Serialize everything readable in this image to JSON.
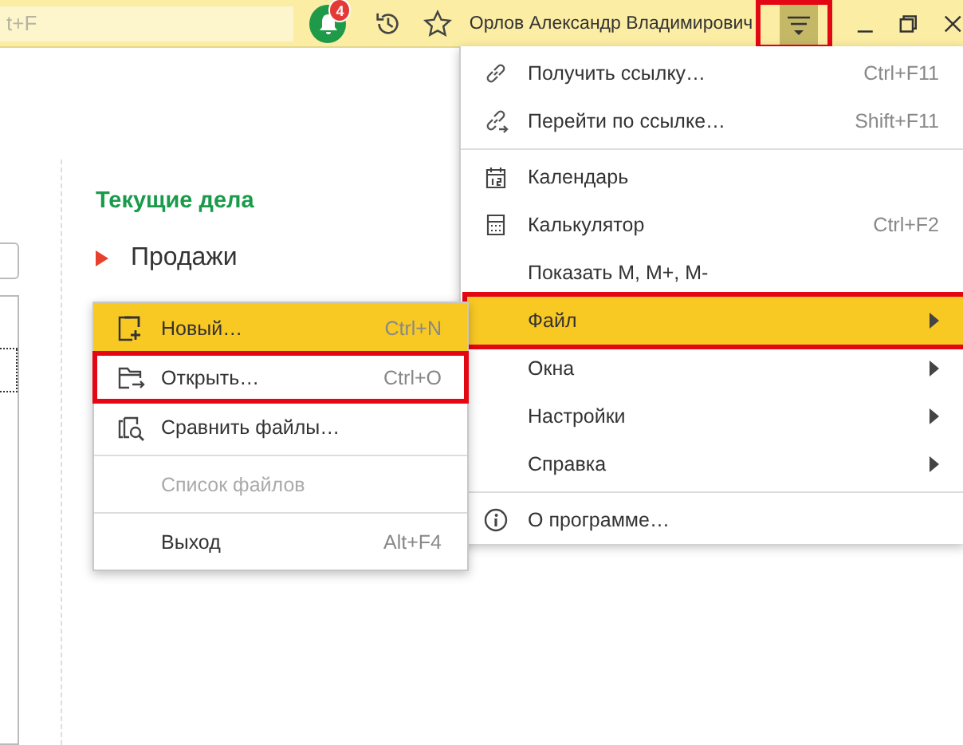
{
  "search": {
    "placeholder": "t+F"
  },
  "notifications": {
    "badge": "4"
  },
  "user_name": "Орлов Александр Владимирович",
  "menu_button": {
    "annotated": true
  },
  "sections": {
    "title": "Текущие дела",
    "items": [
      {
        "label": "Продажи"
      }
    ]
  },
  "main_menu": {
    "groups": [
      [
        {
          "label": "Получить ссылку…",
          "shortcut": "Ctrl+F11",
          "selected": false,
          "annotated": false,
          "has_submenu": false
        },
        {
          "label": "Перейти по ссылке…",
          "shortcut": "Shift+F11",
          "selected": false,
          "annotated": false,
          "has_submenu": false
        }
      ],
      [
        {
          "label": "Календарь",
          "selected": false,
          "annotated": false,
          "has_submenu": false
        },
        {
          "label": "Калькулятор",
          "shortcut": "Ctrl+F2",
          "selected": false,
          "annotated": false,
          "has_submenu": false
        },
        {
          "label": "Показать М, М+, М-",
          "selected": false,
          "annotated": false,
          "has_submenu": false
        },
        {
          "label": "Файл",
          "selected": true,
          "annotated": true,
          "has_submenu": true
        },
        {
          "label": "Окна",
          "selected": false,
          "annotated": false,
          "has_submenu": true
        },
        {
          "label": "Настройки",
          "selected": false,
          "annotated": false,
          "has_submenu": true
        },
        {
          "label": "Справка",
          "selected": false,
          "annotated": false,
          "has_submenu": true
        }
      ],
      [
        {
          "label": "О программе…",
          "selected": false,
          "annotated": false,
          "has_submenu": false
        }
      ]
    ]
  },
  "file_menu": {
    "groups": [
      [
        {
          "label": "Новый…",
          "shortcut": "Ctrl+N",
          "selected": true,
          "annotated": false,
          "disabled": false
        },
        {
          "label": "Открыть…",
          "shortcut": "Ctrl+O",
          "selected": false,
          "annotated": true,
          "disabled": false
        },
        {
          "label": "Сравнить файлы…",
          "selected": false,
          "annotated": false,
          "disabled": false
        }
      ],
      [
        {
          "label": "Список файлов",
          "selected": false,
          "annotated": false,
          "disabled": true
        }
      ],
      [
        {
          "label": "Выход",
          "shortcut": "Alt+F4",
          "selected": false,
          "annotated": false,
          "disabled": false
        }
      ]
    ]
  }
}
